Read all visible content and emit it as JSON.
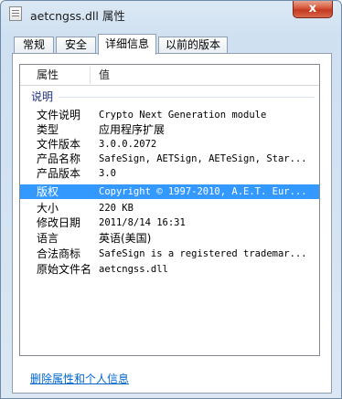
{
  "window": {
    "title": "aetcngss.dll 属性",
    "close_symbol": "x"
  },
  "tabs": [
    {
      "label": "常规",
      "active": false
    },
    {
      "label": "安全",
      "active": false
    },
    {
      "label": "详细信息",
      "active": true
    },
    {
      "label": "以前的版本",
      "active": false
    }
  ],
  "list": {
    "columns": [
      "属性",
      "值"
    ],
    "group_label": "说明",
    "rows": [
      {
        "key": "文件说明",
        "value": "Crypto Next Generation module",
        "selected": false
      },
      {
        "key": "类型",
        "value": "应用程序扩展",
        "selected": false
      },
      {
        "key": "文件版本",
        "value": "3.0.0.2072",
        "selected": false
      },
      {
        "key": "产品名称",
        "value": "SafeSign, AETSign, AETeSign, Star...",
        "selected": false
      },
      {
        "key": "产品版本",
        "value": "3.0",
        "selected": false
      },
      {
        "key": "版权",
        "value": "Copyright © 1997-2010, A.E.T. Eur...",
        "selected": true
      },
      {
        "key": "大小",
        "value": "220 KB",
        "selected": false
      },
      {
        "key": "修改日期",
        "value": "2011/8/14 16:31",
        "selected": false
      },
      {
        "key": "语言",
        "value": "英语(美国)",
        "selected": false
      },
      {
        "key": "合法商标",
        "value": "SafeSign is a registered trademar...",
        "selected": false
      },
      {
        "key": "原始文件名",
        "value": "aetcngss.dll",
        "selected": false
      }
    ]
  },
  "footer": {
    "remove_link": "删除属性和个人信息"
  },
  "colors": {
    "selection": "#3399ff",
    "link": "#0066cc",
    "group_label": "#1e3287",
    "close_button": "#c23a1f"
  }
}
